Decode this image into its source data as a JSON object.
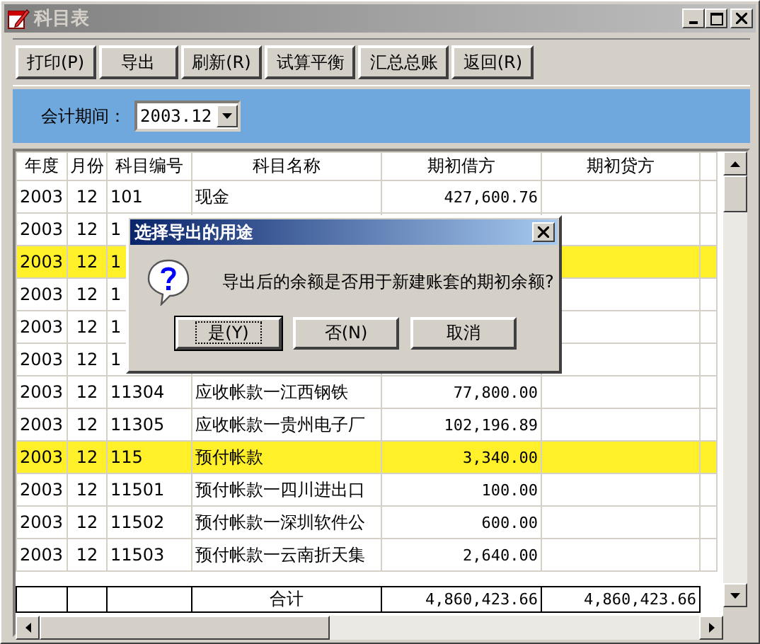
{
  "window": {
    "title": "科目表"
  },
  "toolbar": [
    "打印(P)",
    "导出",
    "刷新(R)",
    "试算平衡",
    "汇总总账",
    "返回(R)"
  ],
  "period": {
    "label": "会计期间：",
    "value": "2003.12"
  },
  "table": {
    "columns": [
      "年度",
      "月份",
      "科目编号",
      "科目名称",
      "期初借方",
      "期初贷方"
    ],
    "rows": [
      {
        "year": "2003",
        "month": "12",
        "code": "101",
        "name": "现金",
        "debit": "427,600.76",
        "highlighted": false
      },
      {
        "year": "2003",
        "month": "12",
        "code": "1",
        "highlighted": false
      },
      {
        "year": "2003",
        "month": "12",
        "code": "1",
        "highlighted": true
      },
      {
        "year": "2003",
        "month": "12",
        "code": "1",
        "highlighted": false
      },
      {
        "year": "2003",
        "month": "12",
        "code": "1",
        "highlighted": false
      },
      {
        "year": "2003",
        "month": "12",
        "code": "1",
        "highlighted": false
      },
      {
        "year": "2003",
        "month": "12",
        "code": "11304",
        "name": "应收帐款一江西钢铁",
        "debit": "77,800.00",
        "highlighted": false
      },
      {
        "year": "2003",
        "month": "12",
        "code": "11305",
        "name": "应收帐款一贵州电子厂",
        "debit": "102,196.89",
        "highlighted": false
      },
      {
        "year": "2003",
        "month": "12",
        "code": "115",
        "name": "预付帐款",
        "debit": "3,340.00",
        "highlighted": true
      },
      {
        "year": "2003",
        "month": "12",
        "code": "11501",
        "name": "预付帐款一四川进出口",
        "debit": "100.00",
        "highlighted": false
      },
      {
        "year": "2003",
        "month": "12",
        "code": "11502",
        "name": "预付帐款一深圳软件公",
        "debit": "600.00",
        "highlighted": false
      },
      {
        "year": "2003",
        "month": "12",
        "code": "11503",
        "name": "预付帐款一云南折天集",
        "debit": "2,640.00",
        "highlighted": false
      }
    ],
    "total": {
      "label": "合计",
      "debit": "4,860,423.66",
      "credit": "4,860,423.66"
    }
  },
  "dialog": {
    "title": "选择导出的用途",
    "message": "导出后的余额是否用于新建账套的期初余额?",
    "buttons": [
      {
        "label": "是(Y)",
        "focused": true
      },
      {
        "label": "否(N)",
        "focused": false
      },
      {
        "label": "取消",
        "focused": false
      }
    ]
  }
}
